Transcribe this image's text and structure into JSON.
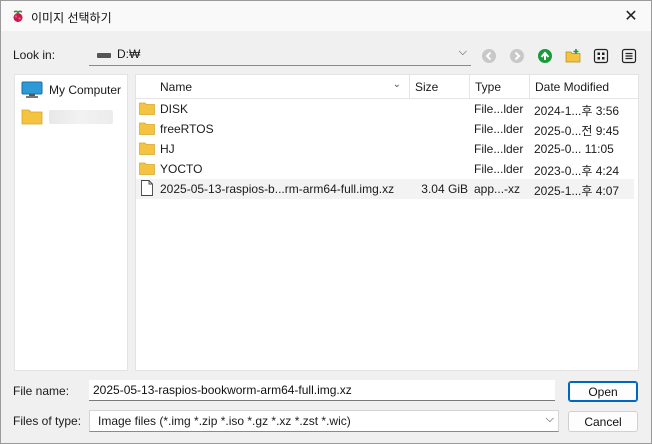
{
  "window": {
    "title": "이미지 선택하기",
    "close_label": "✕"
  },
  "lookin": {
    "label": "Look in:",
    "value": "D:₩"
  },
  "toolbar": {
    "icons": [
      "back-icon",
      "forward-icon",
      "parent-directory-icon",
      "new-folder-icon",
      "list-view-icon",
      "detail-view-icon"
    ]
  },
  "sidebar": {
    "items": [
      {
        "label": "My Computer",
        "icon": "computer-icon"
      },
      {
        "label": "",
        "icon": "folder-icon"
      }
    ]
  },
  "table": {
    "columns": [
      "Name",
      "Size",
      "Type",
      "Date Modified"
    ],
    "rows": [
      {
        "name": "DISK",
        "size": "",
        "type": "File...lder",
        "date": "2024-1...후 3:56",
        "kind": "folder"
      },
      {
        "name": "freeRTOS",
        "size": "",
        "type": "File...lder",
        "date": "2025-0...전 9:45",
        "kind": "folder"
      },
      {
        "name": "HJ",
        "size": "",
        "type": "File...lder",
        "date": "2025-0... 11:05",
        "kind": "folder"
      },
      {
        "name": "YOCTO",
        "size": "",
        "type": "File...lder",
        "date": "2023-0...후 4:24",
        "kind": "folder"
      },
      {
        "name": "2025-05-13-raspios-b...rm-arm64-full.img.xz",
        "size": "3.04 GiB",
        "type": "app...-xz",
        "date": "2025-1...후 4:07",
        "kind": "file"
      }
    ]
  },
  "file_name": {
    "label": "File name:",
    "value": "2025-05-13-raspios-bookworm-arm64-full.img.xz"
  },
  "file_type": {
    "label": "Files of type:",
    "value": "Image files (*.img *.zip *.iso *.gz *.xz *.zst *.wic)"
  },
  "buttons": {
    "open": "Open",
    "cancel": "Cancel"
  },
  "colors": {
    "folder": "#f4c33f",
    "accent": "#0067c0",
    "up_arrow": "#1a9b3b"
  }
}
